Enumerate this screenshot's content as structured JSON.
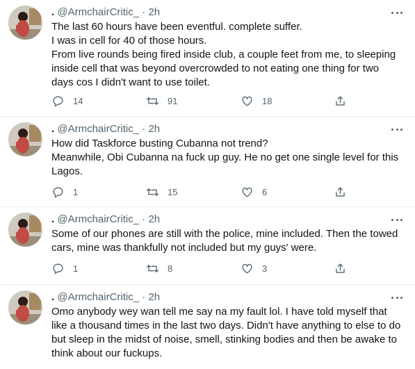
{
  "tweets": [
    {
      "name": ".",
      "handle": "@ArmchairCritic_",
      "sep": "·",
      "time": "2h",
      "lines": [
        "The last 60 hours have been eventful. complete suffer.",
        "I was in cell for 40 of those hours.",
        "From live rounds being fired inside club, a couple feet from me, to sleeping",
        "inside cell that was beyond overcrowded to not eating one thing for two",
        "days cos I didn't want to use toilet."
      ],
      "replies": "14",
      "retweets": "91",
      "likes": "18"
    },
    {
      "name": ".",
      "handle": "@ArmchairCritic_",
      "sep": "·",
      "time": "2h",
      "lines": [
        "How did Taskforce busting Cubanna not trend?",
        "Meanwhile, Obi Cubanna na fuck up guy. He no get one single level for this",
        "Lagos."
      ],
      "replies": "1",
      "retweets": "15",
      "likes": "6"
    },
    {
      "name": ".",
      "handle": "@ArmchairCritic_",
      "sep": "·",
      "time": "2h",
      "lines": [
        "Some of our phones are still with the police, mine included. Then the towed",
        "cars, mine was thankfully not included but my guys' were."
      ],
      "replies": "1",
      "retweets": "8",
      "likes": "3"
    },
    {
      "name": ".",
      "handle": "@ArmchairCritic_",
      "sep": "·",
      "time": "2h",
      "lines": [
        "Omo anybody wey wan tell me say na my fault lol. I have told myself that",
        "like a thousand times in the last two days. Didn't have anything to else to do",
        "but sleep in the midst of noise, smell, stinking bodies and then be awake to",
        "think about our fuckups."
      ],
      "replies": "",
      "retweets": "",
      "likes": ""
    }
  ],
  "icons": {
    "reply": "reply-icon",
    "retweet": "retweet-icon",
    "like": "heart-icon",
    "share": "share-icon",
    "more": "more-icon"
  },
  "colors": {
    "text": "#0f1419",
    "secondary": "#536471",
    "divider": "#e6ecf0"
  }
}
